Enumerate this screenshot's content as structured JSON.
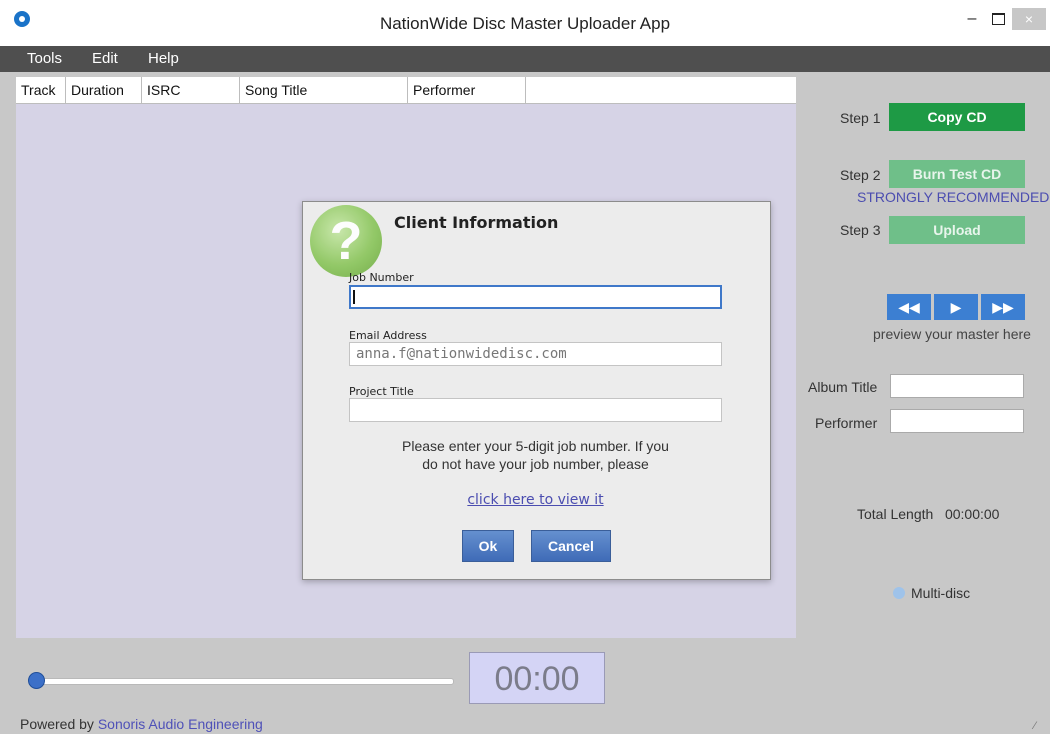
{
  "window": {
    "title": "NationWide Disc Master Uploader App",
    "minimize": "–",
    "close": "×"
  },
  "menu": {
    "items": [
      "Tools",
      "Edit",
      "Help"
    ]
  },
  "table": {
    "columns": [
      "Track",
      "Duration",
      "ISRC",
      "Song Title",
      "Performer"
    ]
  },
  "steps": [
    {
      "label": "Step 1",
      "button": "Copy CD"
    },
    {
      "label": "Step 2",
      "button": "Burn Test CD"
    },
    {
      "label": "Step 3",
      "button": "Upload"
    }
  ],
  "recommend": "STRONGLY RECOMMENDED",
  "media": {
    "rewind": "◀◀",
    "play": "▶",
    "forward": "▶▶",
    "preview_text": "preview your master here"
  },
  "album": {
    "album_title_label": "Album Title",
    "performer_label": "Performer"
  },
  "total_length": {
    "label": "Total Length",
    "value": "00:00:00"
  },
  "multi_disc_label": "Multi-disc",
  "player": {
    "time": "00:00"
  },
  "footer": {
    "powered_by": "Powered by",
    "company": "Sonoris Audio Engineering"
  },
  "dialog": {
    "title": "Client Information",
    "job_number_label": "Job Number",
    "job_number_value": "",
    "email_label": "Email Address",
    "email_value": "anna.f@nationwidedisc.com",
    "project_title_label": "Project Title",
    "project_title_value": "",
    "message_line1": "Please enter your 5-digit job number. If you",
    "message_line2": "do not have your job number, please",
    "link": "click here to view it",
    "ok": "Ok",
    "cancel": "Cancel"
  },
  "colors": {
    "accent_green": "#1e9a45",
    "accent_blue": "#3c7fd2",
    "table_bg": "#d6d3e6"
  }
}
